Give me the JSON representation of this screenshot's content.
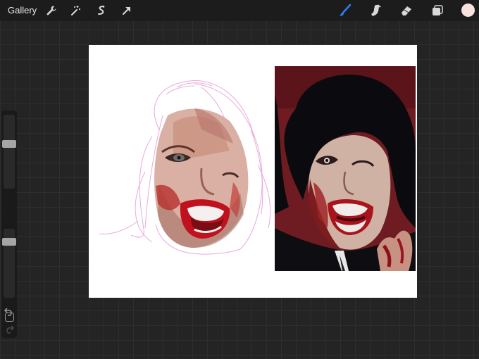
{
  "app": {
    "gallery_label": "Gallery"
  },
  "toolbar": {
    "left_icons": [
      "wrench-icon",
      "magic-wand-icon",
      "selection-icon",
      "transform-arrow-icon"
    ],
    "right_icons": [
      "brush-icon",
      "smudge-icon",
      "eraser-icon",
      "layers-icon"
    ],
    "active_tool": "brush",
    "accent_color": "#2f7ff0",
    "current_color": "#f9e1e0"
  },
  "sidebar": {
    "brush_size_level": 0.62,
    "opacity_level": 0.85,
    "icons": [
      "modify-square-icon",
      "undo-icon",
      "redo-icon"
    ]
  },
  "canvas": {
    "background": "#ffffff",
    "content": [
      "sketch-painting",
      "reference-photo"
    ]
  }
}
